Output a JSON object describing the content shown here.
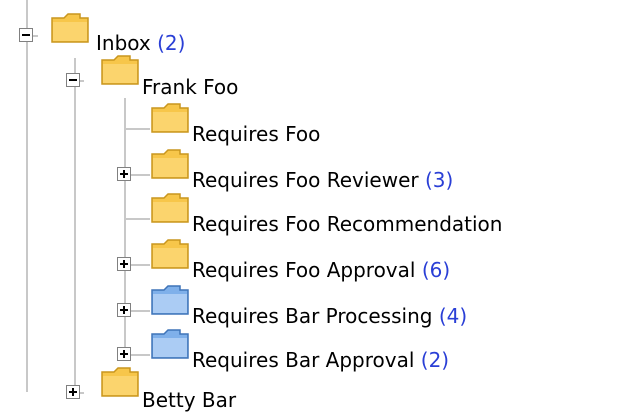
{
  "tree": {
    "inbox": {
      "label": "Inbox",
      "count": "(2)"
    },
    "frank": {
      "label": "Frank Foo"
    },
    "items": [
      {
        "label": "Requires Foo",
        "count": ""
      },
      {
        "label": "Requires Foo Reviewer",
        "count": "(3)"
      },
      {
        "label": "Requires Foo Recommendation",
        "count": ""
      },
      {
        "label": "Requires Foo Approval",
        "count": "(6)"
      },
      {
        "label": "Requires Bar Processing",
        "count": "(4)"
      },
      {
        "label": "Requires Bar Approval",
        "count": "(2)"
      }
    ],
    "betty": {
      "label": "Betty Bar"
    }
  },
  "colors": {
    "folder_yellow": "#f7c64a",
    "folder_blue": "#7fb0ea",
    "count_blue": "#2a3fd6",
    "connector": "#c8c8c8"
  }
}
